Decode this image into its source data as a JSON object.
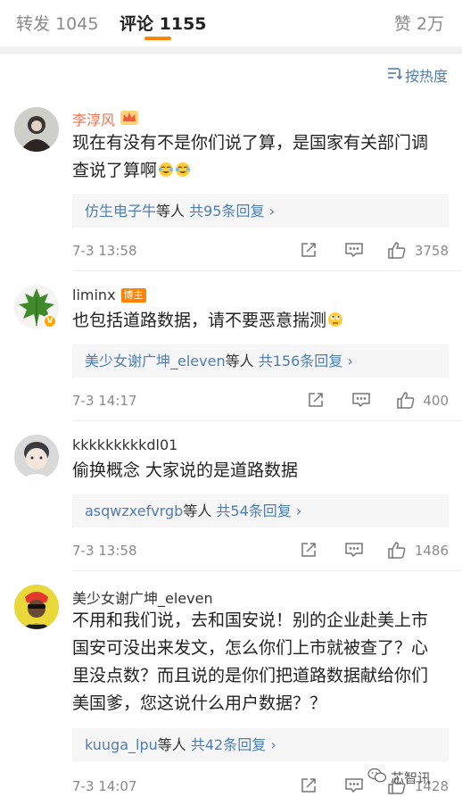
{
  "tabs": {
    "repost_label": "转发",
    "repost_count": "1045",
    "comment_label": "评论",
    "comment_count": "1155",
    "like_label": "赞",
    "like_count": "2万"
  },
  "sort_label": "按热度",
  "comments": [
    {
      "username": "李淳风",
      "text_line1": "现在有没有不是你们说了算，是国家有关部门调",
      "text_line2": "查说了算啊",
      "reply_user": "仿生电子牛",
      "reply_mid": "等人",
      "reply_total": "共95条回复 ›",
      "time": "7-3 13:58",
      "likes": "3758"
    },
    {
      "username": "liminx",
      "badge": "博主",
      "text_line1": "也包括道路数据，请不要恶意揣测",
      "reply_user": "美少女谢广坤_eleven",
      "reply_mid": "等人",
      "reply_total": "共156条回复 ›",
      "time": "7-3 14:17",
      "likes": "400"
    },
    {
      "username": "kkkkkkkkkdl01",
      "text_line1": "偷换概念 大家说的是道路数据",
      "reply_user": "asqwzxefvrgb",
      "reply_mid": "等人",
      "reply_total": "共54条回复 ›",
      "time": "7-3 13:58",
      "likes": "1486"
    },
    {
      "username": "美少女谢广坤_eleven",
      "text_line1": "不用和我们说，去和国安说！别的企业赴美上市",
      "text_line2": "国安可没出来发文，怎么你们上市就被查了？心",
      "text_line3": "里没点数？而且说的是你们把道路数据献给你们",
      "text_line4": "美国爹，您这说什么用户数据？？",
      "reply_user": "kuuga_lpu",
      "reply_mid": "等人",
      "reply_total": "共42条回复 ›",
      "time": "7-3 14:07",
      "likes": "1428"
    }
  ],
  "watermark": "芯智讯",
  "colors": {
    "accent": "#ff8200",
    "link": "#507daf",
    "username_highlight": "#eb7350"
  }
}
